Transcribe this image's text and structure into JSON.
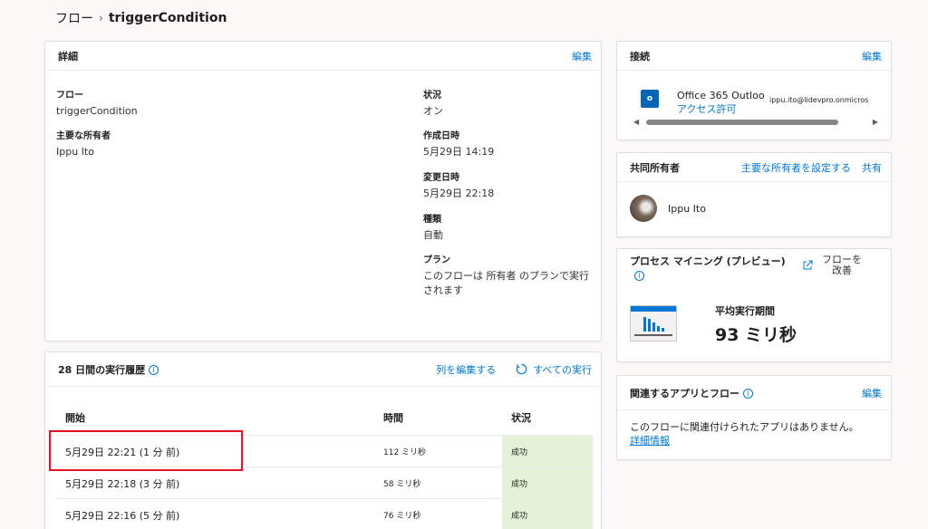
{
  "breadcrumb": {
    "root": "フロー",
    "sep": "›",
    "current": "triggerCondition"
  },
  "details": {
    "title": "詳細",
    "edit": "編集",
    "flow_label": "フロー",
    "flow_value": "triggerCondition",
    "owner_label": "主要な所有者",
    "owner_value": "Ippu Ito",
    "status_label": "状況",
    "status_value": "オン",
    "created_label": "作成日時",
    "created_value": "5月29日 14:19",
    "modified_label": "変更日時",
    "modified_value": "5月29日 22:18",
    "type_label": "種類",
    "type_value": "自動",
    "plan_label": "プラン",
    "plan_value": "このフローは 所有者 のプランで実行されます"
  },
  "history": {
    "title": "28 日間の実行履歴",
    "info": "i",
    "edit_columns": "列を編集する",
    "all_runs": "すべての実行",
    "headers": {
      "start": "開始",
      "duration": "時間",
      "status": "状況"
    },
    "rows": [
      {
        "start": "5月29日 22:21 (1 分 前)",
        "duration": "112 ミリ秒",
        "status": "成功"
      },
      {
        "start": "5月29日 22:18 (3 分 前)",
        "duration": "58 ミリ秒",
        "status": "成功"
      },
      {
        "start": "5月29日 22:16 (5 分 前)",
        "duration": "76 ミリ秒",
        "status": "成功"
      }
    ]
  },
  "connections": {
    "title": "接続",
    "edit": "編集",
    "name": "Office 365 Outloo",
    "access": "アクセス許可",
    "email": "ippu.ito@lidevpro.onmicros"
  },
  "coowners": {
    "title": "共同所有者",
    "set_owner": "主要な所有者を設定する",
    "share": "共有",
    "name": "Ippu Ito"
  },
  "process_mining": {
    "title": "プロセス マイニング (プレビュー)",
    "info": "i",
    "improve": "フローを改善",
    "avg_label": "平均実行期間",
    "avg_value": "93 ミリ秒"
  },
  "related": {
    "title": "関連するアプリとフロー",
    "info": "i",
    "edit": "編集",
    "empty": "このフローに関連付けられたアプリはありません。",
    "more": "詳細情報"
  },
  "colors": {
    "accent": "#0078d4",
    "success_bg": "#e6f2d7",
    "highlight": "#e81123"
  }
}
